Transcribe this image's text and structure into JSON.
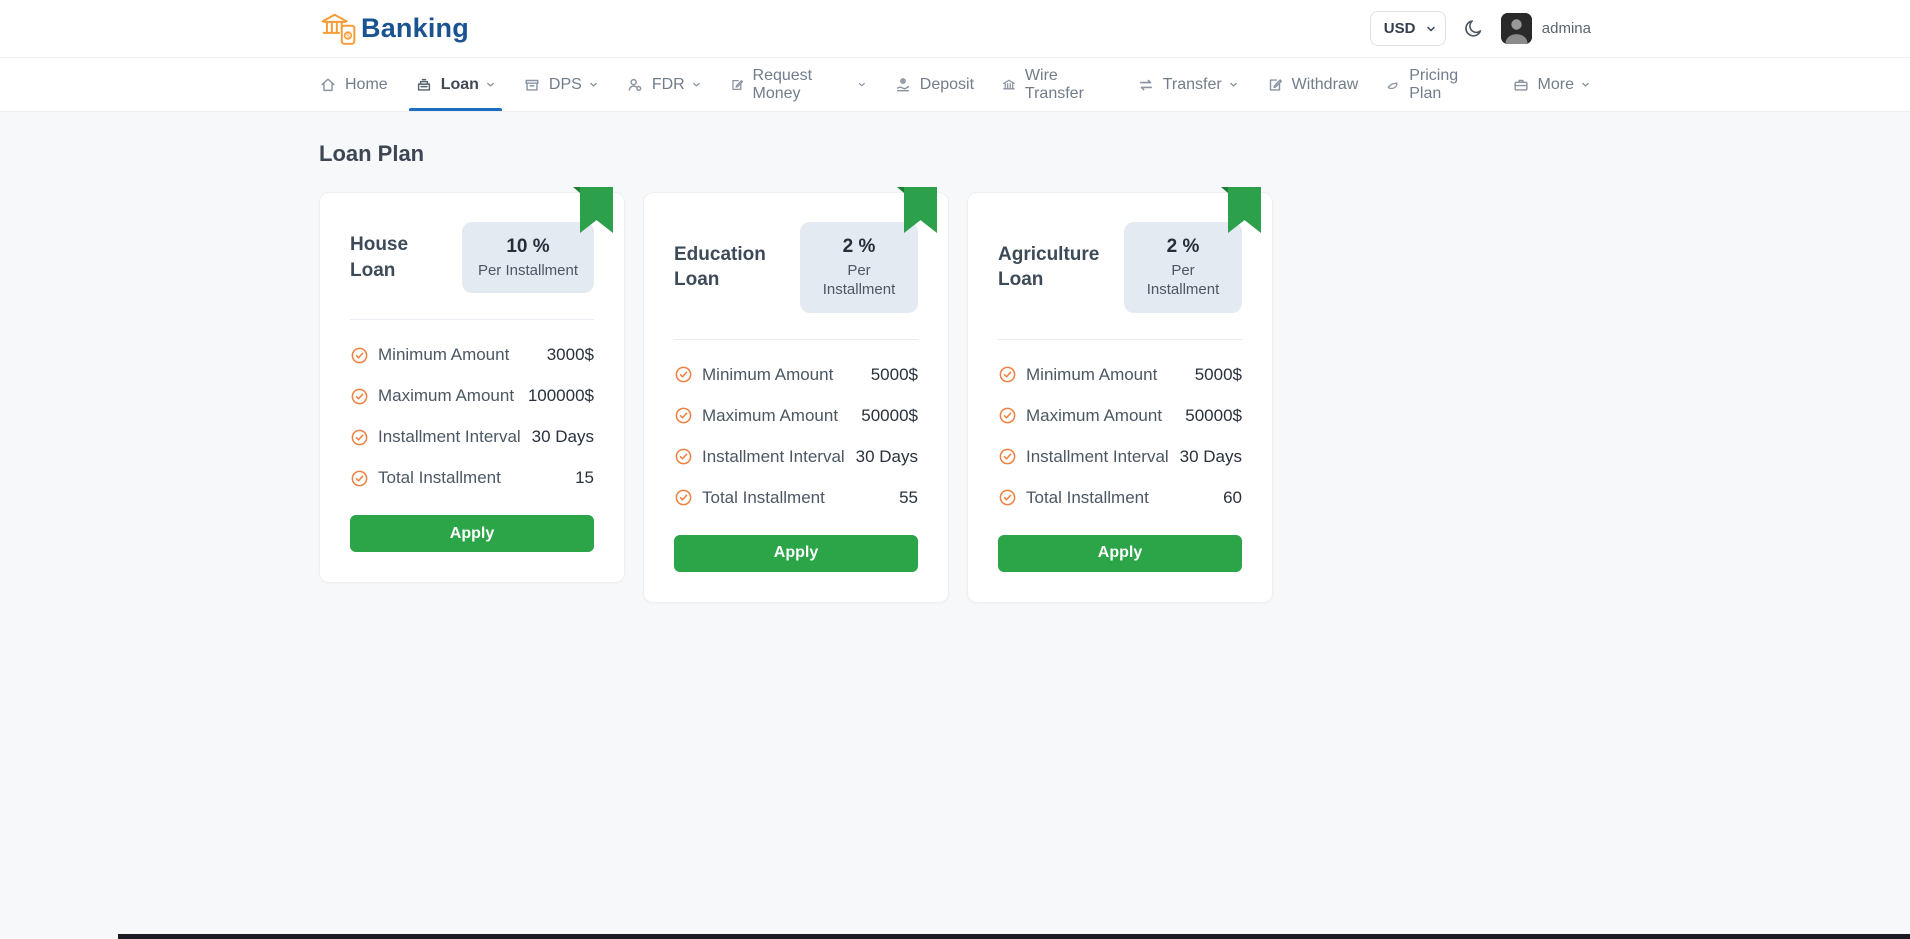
{
  "header": {
    "brand": "Banking",
    "currency": "USD",
    "username": "admina"
  },
  "nav": {
    "items": [
      {
        "label": "Home",
        "icon": "home-icon",
        "dropdown": false,
        "active": false
      },
      {
        "label": "Loan",
        "icon": "loan-icon",
        "dropdown": true,
        "active": true
      },
      {
        "label": "DPS",
        "icon": "dps-icon",
        "dropdown": true,
        "active": false
      },
      {
        "label": "FDR",
        "icon": "fdr-icon",
        "dropdown": true,
        "active": false
      },
      {
        "label": "Request Money",
        "icon": "request-money-icon",
        "dropdown": true,
        "active": false
      },
      {
        "label": "Deposit",
        "icon": "deposit-icon",
        "dropdown": false,
        "active": false
      },
      {
        "label": "Wire Transfer",
        "icon": "wire-transfer-icon",
        "dropdown": false,
        "active": false
      },
      {
        "label": "Transfer",
        "icon": "transfer-icon",
        "dropdown": true,
        "active": false
      },
      {
        "label": "Withdraw",
        "icon": "withdraw-icon",
        "dropdown": false,
        "active": false
      },
      {
        "label": "Pricing Plan",
        "icon": "pricing-plan-icon",
        "dropdown": false,
        "active": false
      },
      {
        "label": "More",
        "icon": "more-icon",
        "dropdown": true,
        "active": false
      }
    ]
  },
  "page": {
    "title": "Loan Plan"
  },
  "plans": [
    {
      "name": "House Loan",
      "rate": "10 %",
      "rate_caption": "Per Installment",
      "features": [
        {
          "label": "Minimum Amount",
          "value": "3000$"
        },
        {
          "label": "Maximum Amount",
          "value": "100000$"
        },
        {
          "label": "Installment Interval",
          "value": "30 Days"
        },
        {
          "label": "Total Installment",
          "value": "15"
        }
      ],
      "apply_label": "Apply"
    },
    {
      "name": "Education Loan",
      "rate": "2 %",
      "rate_caption": "Per\nInstallment",
      "features": [
        {
          "label": "Minimum Amount",
          "value": "5000$"
        },
        {
          "label": "Maximum Amount",
          "value": "50000$"
        },
        {
          "label": "Installment Interval",
          "value": "30 Days"
        },
        {
          "label": "Total Installment",
          "value": "55"
        }
      ],
      "apply_label": "Apply"
    },
    {
      "name": "Agriculture Loan",
      "rate": "2 %",
      "rate_caption": "Per\nInstallment",
      "features": [
        {
          "label": "Minimum Amount",
          "value": "5000$"
        },
        {
          "label": "Maximum Amount",
          "value": "50000$"
        },
        {
          "label": "Installment Interval",
          "value": "30 Days"
        },
        {
          "label": "Total Installment",
          "value": "60"
        }
      ],
      "apply_label": "Apply"
    }
  ],
  "colors": {
    "brand_orange": "#f59c36",
    "brand_blue": "#1a5391",
    "nav_active_blue": "#1b6ec2",
    "accent_green": "#2ba548",
    "ribbon_green": "#2ca04a",
    "ribbon_fold_green": "#1e7e34",
    "check_orange": "#ee8142",
    "badge_bg": "#e4eaf2"
  }
}
